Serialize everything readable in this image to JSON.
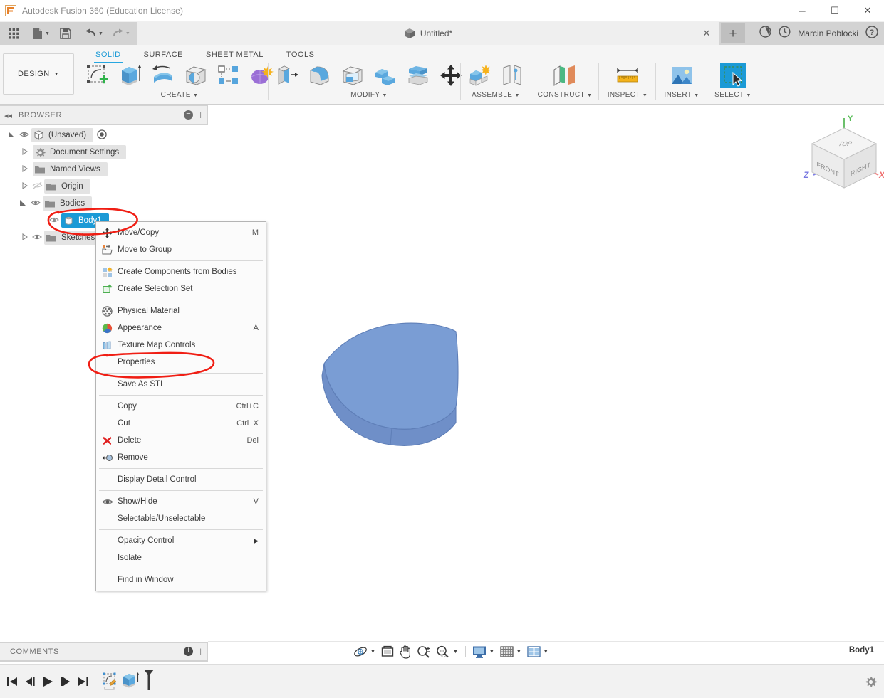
{
  "window": {
    "title": "Autodesk Fusion 360 (Education License)",
    "logo_icon": "fusion-logo-icon",
    "minimize_icon": "minimize-icon",
    "maximize_icon": "maximize-icon",
    "close_icon": "close-icon",
    "minimize_glyph": "─",
    "maximize_glyph": "☐",
    "close_glyph": "✕"
  },
  "quick_access": {
    "items": [
      {
        "name": "app-grid-button",
        "icon": "grid-apps-icon",
        "caret": false
      },
      {
        "name": "new-file-button",
        "icon": "file-new-icon",
        "caret": true
      },
      {
        "name": "save-button",
        "icon": "save-disk-icon",
        "caret": false
      },
      {
        "name": "undo-button",
        "icon": "undo-arrow-icon",
        "caret": true
      },
      {
        "name": "redo-button",
        "icon": "redo-arrow-icon",
        "caret": true
      }
    ]
  },
  "document_tab": {
    "label": "Untitled*",
    "icon": "cube-document-icon",
    "close_glyph": "✕",
    "new_tab_glyph": "+"
  },
  "account_bar": {
    "user_name": "Marcin Poblocki",
    "icons": [
      {
        "name": "job-status-icon",
        "glyph": "◔"
      },
      {
        "name": "recent-activity-icon",
        "glyph": "◴"
      },
      {
        "name": "help-icon",
        "glyph": "?"
      }
    ]
  },
  "workspace": {
    "selector_label": "DESIGN",
    "selector_caret": "▼",
    "tabs": [
      {
        "label": "SOLID",
        "active": true
      },
      {
        "label": "SURFACE",
        "active": false
      },
      {
        "label": "SHEET METAL",
        "active": false
      },
      {
        "label": "TOOLS",
        "active": false
      }
    ]
  },
  "ribbon": {
    "panels": [
      {
        "name": "create-panel",
        "label": "CREATE",
        "caret": "▾",
        "tools": [
          {
            "name": "create-sketch-tool",
            "icon": "new-sketch-icon"
          },
          {
            "name": "extrude-tool",
            "icon": "extrude-icon"
          },
          {
            "name": "revolve-tool",
            "icon": "revolve-icon"
          },
          {
            "name": "hole-tool",
            "icon": "hole-icon"
          },
          {
            "name": "rectangular-pattern-tool",
            "icon": "pattern-icon"
          },
          {
            "name": "create-form-tool",
            "icon": "form-sculpt-icon"
          }
        ]
      },
      {
        "name": "modify-panel",
        "label": "MODIFY",
        "caret": "▾",
        "tools": [
          {
            "name": "press-pull-tool",
            "icon": "press-pull-icon"
          },
          {
            "name": "fillet-tool",
            "icon": "fillet-icon"
          },
          {
            "name": "shell-tool",
            "icon": "shell-icon"
          },
          {
            "name": "combine-tool",
            "icon": "combine-icon"
          },
          {
            "name": "offset-face-tool",
            "icon": "offset-face-icon"
          },
          {
            "name": "move-copy-tool",
            "icon": "move-arrows-icon"
          }
        ]
      },
      {
        "name": "assemble-panel",
        "label": "ASSEMBLE",
        "caret": "▾",
        "tools": [
          {
            "name": "new-component-tool",
            "icon": "new-component-icon"
          },
          {
            "name": "joint-tool",
            "icon": "joint-icon"
          }
        ]
      },
      {
        "name": "construct-panel",
        "label": "CONSTRUCT",
        "caret": "▾",
        "tools": [
          {
            "name": "offset-plane-tool",
            "icon": "construct-plane-icon"
          }
        ]
      },
      {
        "name": "inspect-panel",
        "label": "INSPECT",
        "caret": "▾",
        "tools": [
          {
            "name": "measure-tool",
            "icon": "ruler-measure-icon"
          }
        ]
      },
      {
        "name": "insert-panel",
        "label": "INSERT",
        "caret": "▾",
        "tools": [
          {
            "name": "insert-image-tool",
            "icon": "picture-insert-icon"
          }
        ]
      },
      {
        "name": "select-panel",
        "label": "SELECT",
        "caret": "▾",
        "tools": [
          {
            "name": "select-tool",
            "icon": "select-cursor-icon"
          }
        ]
      }
    ]
  },
  "browser": {
    "title": "BROWSER",
    "collapse_glyph": "◂◂",
    "dot_glyph": "−",
    "grip_glyph": "‖",
    "tree": [
      {
        "name": "tree-item-unsaved",
        "label": "(Unsaved)",
        "arrow": "expanded",
        "eye": true,
        "icon": "document-cube-icon",
        "indent": 0,
        "selected": false,
        "radio": true
      },
      {
        "name": "tree-item-document-settings",
        "label": "Document Settings",
        "arrow": "collapsed",
        "eye": false,
        "icon": "gear-icon",
        "indent": 1,
        "selected": false,
        "radio": false
      },
      {
        "name": "tree-item-named-views",
        "label": "Named Views",
        "arrow": "collapsed",
        "eye": false,
        "icon": "folder-icon",
        "indent": 1,
        "selected": false,
        "radio": false
      },
      {
        "name": "tree-item-origin",
        "label": "Origin",
        "arrow": "collapsed",
        "eye": "off",
        "icon": "folder-icon",
        "indent": 1,
        "selected": false,
        "radio": false
      },
      {
        "name": "tree-item-bodies",
        "label": "Bodies",
        "arrow": "expanded",
        "eye": true,
        "icon": "folder-icon",
        "indent": 1,
        "selected": false,
        "radio": false
      },
      {
        "name": "tree-item-body1",
        "label": "Body1",
        "arrow": "none",
        "eye": true,
        "icon": "body-cylinder-icon",
        "indent": 2,
        "selected": true,
        "radio": false
      },
      {
        "name": "tree-item-sketches",
        "label": "Sketches",
        "arrow": "collapsed",
        "eye": true,
        "icon": "folder-icon",
        "indent": 1,
        "selected": false,
        "radio": false
      }
    ]
  },
  "context_menu": {
    "items": [
      {
        "type": "item",
        "name": "menu-move-copy",
        "label": "Move/Copy",
        "shortcut": "M",
        "icon": "move-arrows-icon"
      },
      {
        "type": "item",
        "name": "menu-move-to-group",
        "label": "Move to Group",
        "shortcut": "",
        "icon": "move-to-group-icon"
      },
      {
        "type": "sep"
      },
      {
        "type": "item",
        "name": "menu-create-components-from-bodies",
        "label": "Create Components from Bodies",
        "shortcut": "",
        "icon": "create-components-icon"
      },
      {
        "type": "item",
        "name": "menu-create-selection-set",
        "label": "Create Selection Set",
        "shortcut": "",
        "icon": "selection-set-icon"
      },
      {
        "type": "sep"
      },
      {
        "type": "item",
        "name": "menu-physical-material",
        "label": "Physical Material",
        "shortcut": "",
        "icon": "physical-material-icon"
      },
      {
        "type": "item",
        "name": "menu-appearance",
        "label": "Appearance",
        "shortcut": "A",
        "icon": "appearance-icon"
      },
      {
        "type": "item",
        "name": "menu-texture-map-controls",
        "label": "Texture Map Controls",
        "shortcut": "",
        "icon": "texture-map-icon"
      },
      {
        "type": "item",
        "name": "menu-properties",
        "label": "Properties",
        "shortcut": "",
        "icon": ""
      },
      {
        "type": "sep"
      },
      {
        "type": "item",
        "name": "menu-save-as-stl",
        "label": "Save As STL",
        "shortcut": "",
        "icon": ""
      },
      {
        "type": "sep"
      },
      {
        "type": "item",
        "name": "menu-copy",
        "label": "Copy",
        "shortcut": "Ctrl+C",
        "icon": ""
      },
      {
        "type": "item",
        "name": "menu-cut",
        "label": "Cut",
        "shortcut": "Ctrl+X",
        "icon": ""
      },
      {
        "type": "item",
        "name": "menu-delete",
        "label": "Delete",
        "shortcut": "Del",
        "icon": "delete-x-icon"
      },
      {
        "type": "item",
        "name": "menu-remove",
        "label": "Remove",
        "shortcut": "",
        "icon": "remove-icon"
      },
      {
        "type": "sep"
      },
      {
        "type": "item",
        "name": "menu-display-detail-control",
        "label": "Display Detail Control",
        "shortcut": "",
        "icon": ""
      },
      {
        "type": "sep"
      },
      {
        "type": "item",
        "name": "menu-show-hide",
        "label": "Show/Hide",
        "shortcut": "V",
        "icon": "eye-icon"
      },
      {
        "type": "item",
        "name": "menu-selectable-unselectable",
        "label": "Selectable/Unselectable",
        "shortcut": "",
        "icon": ""
      },
      {
        "type": "sep"
      },
      {
        "type": "item",
        "name": "menu-opacity-control",
        "label": "Opacity Control",
        "shortcut": "",
        "icon": "",
        "submenu": "▶"
      },
      {
        "type": "item",
        "name": "menu-isolate",
        "label": "Isolate",
        "shortcut": "",
        "icon": ""
      },
      {
        "type": "sep"
      },
      {
        "type": "item",
        "name": "menu-find-in-window",
        "label": "Find in Window",
        "shortcut": "",
        "icon": ""
      }
    ]
  },
  "viewcube": {
    "faces": {
      "top": "TOP",
      "front": "FRONT",
      "right": "RIGHT"
    },
    "axes": {
      "x": "X",
      "y": "Y",
      "z": "Z"
    },
    "axis_colors": {
      "x": "#e08080",
      "y": "#7bc87b",
      "z": "#8080e0"
    }
  },
  "model": {
    "name": "body1-solid",
    "fill_color": "#7296cf",
    "top_color": "#7d9fd6",
    "side_color": "#6b8cc5",
    "edge_color": "#5a79ad"
  },
  "annotations": [
    {
      "name": "annotation-circle-body1",
      "color": "#f01e14"
    },
    {
      "name": "annotation-circle-save-as-stl",
      "color": "#f01e14"
    }
  ],
  "comments": {
    "title": "COMMENTS",
    "dot_glyph": "+",
    "grip_glyph": "‖"
  },
  "status_bar": {
    "selected_body": "Body1",
    "nav_tools": [
      {
        "name": "orbit-tool",
        "icon": "orbit-icon",
        "caret": true
      },
      {
        "name": "fit-view-tool",
        "icon": "fit-icon",
        "caret": false
      },
      {
        "name": "pan-tool",
        "icon": "pan-hand-icon",
        "caret": false
      },
      {
        "name": "zoom-tool",
        "icon": "zoom-magnifier-icon",
        "caret": false
      },
      {
        "name": "zoom-window-tool",
        "icon": "zoom-window-icon",
        "caret": true
      },
      {
        "name": "display-settings-tool",
        "icon": "monitor-display-icon",
        "caret": true
      },
      {
        "name": "grid-snap-tool",
        "icon": "grid-icon",
        "caret": true
      },
      {
        "name": "viewports-tool",
        "icon": "viewports-icon",
        "caret": true
      }
    ]
  },
  "timeline": {
    "controls": [
      {
        "name": "timeline-go-to-beginning",
        "icon": "skip-start-icon"
      },
      {
        "name": "timeline-step-back",
        "icon": "step-back-icon"
      },
      {
        "name": "timeline-play",
        "icon": "play-icon"
      },
      {
        "name": "timeline-step-forward",
        "icon": "step-forward-icon"
      },
      {
        "name": "timeline-go-to-end",
        "icon": "skip-end-icon"
      }
    ],
    "features": [
      {
        "name": "timeline-feature-sketch",
        "icon": "sketch-feature-icon"
      },
      {
        "name": "timeline-feature-extrude",
        "icon": "extrude-feature-icon"
      }
    ],
    "settings_icon": "gear-icon"
  }
}
